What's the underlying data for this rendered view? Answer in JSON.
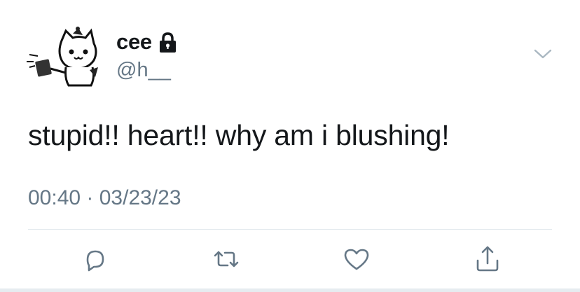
{
  "tweet": {
    "display_name": "cee",
    "handle": "@h__",
    "text": "stupid!! heart!! why am i blushing!",
    "timestamp": "00:40 · 03/23/23"
  },
  "icons": {
    "avatar": "cat-avatar-icon",
    "protected": "lock-icon",
    "menu": "chevron-down-icon",
    "reply": "reply-icon",
    "retweet": "retweet-icon",
    "like": "heart-icon",
    "share": "share-icon"
  },
  "colors": {
    "text": "#14171a",
    "secondary": "#657786",
    "icon": "#657786",
    "divider": "#e1e8ed"
  }
}
